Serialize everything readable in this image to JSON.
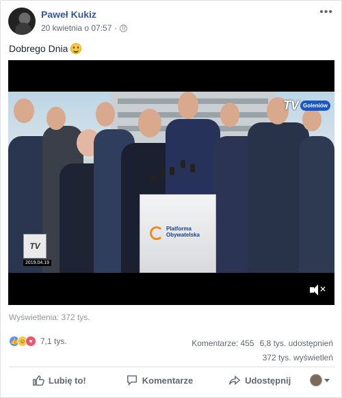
{
  "post": {
    "author": "Paweł Kukiz",
    "timestamp": "20 kwietnia o 07:57",
    "separator": "·",
    "privacy_icon": "globe-icon",
    "text": "Dobrego Dnia"
  },
  "video": {
    "channel_logo": "TV",
    "channel_badge": "Goleniów",
    "small_logo": "TV",
    "date_stamp": "2019.04.19",
    "podium_text": "Platforma Obywatelska",
    "mute_icon": "speaker-muted-icon"
  },
  "footer": {
    "views_label": "Wyświetlenia: 372 tys.",
    "reactions_count": "7,1 tys.",
    "comments": "Komentarze: 455",
    "shares": "6,8 tys. udostępnień",
    "views": "372 tys. wyświetleń"
  },
  "actions": {
    "like": "Lubię to!",
    "comment": "Komentarze",
    "share": "Udostępnij"
  },
  "colors": {
    "author": "#365899",
    "like_reaction": "#5890ff",
    "love_reaction": "#f25268",
    "haha_reaction": "#f7c948"
  }
}
